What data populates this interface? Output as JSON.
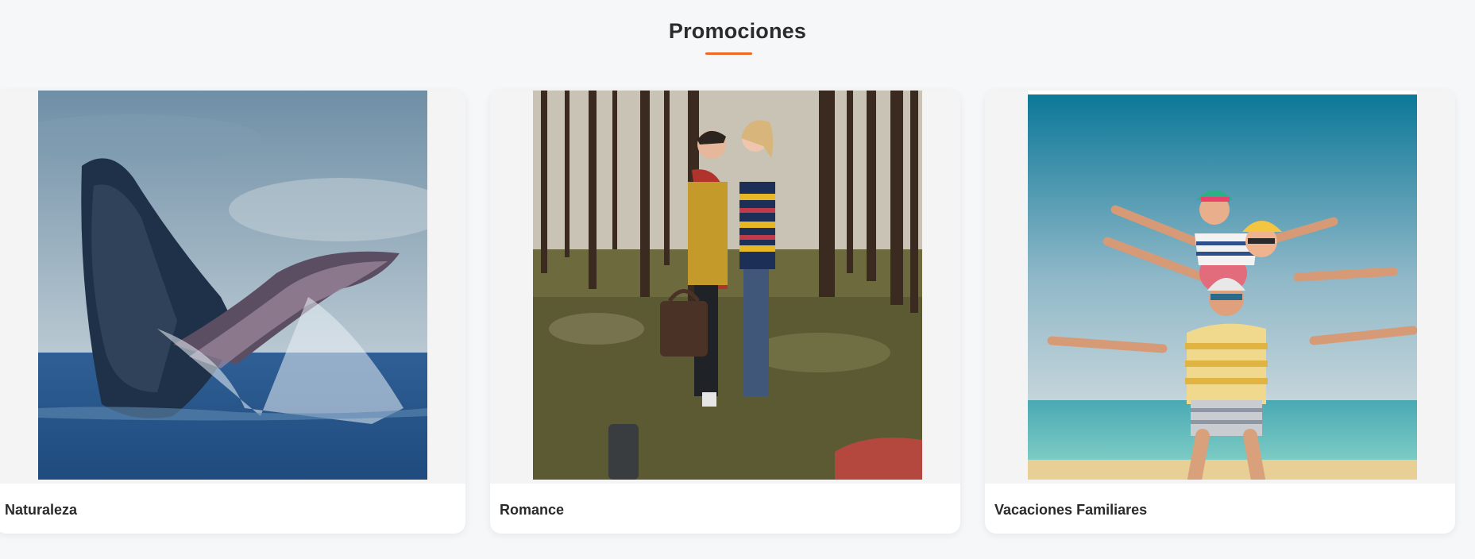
{
  "section": {
    "title": "Promociones",
    "accent_color": "#ee6a22"
  },
  "cards": [
    {
      "title": "Naturaleza",
      "image": "whale-breaching-photo"
    },
    {
      "title": "Romance",
      "image": "couple-in-forest-photo"
    },
    {
      "title": "Vacaciones Familiares",
      "image": "family-beach-photo"
    }
  ]
}
